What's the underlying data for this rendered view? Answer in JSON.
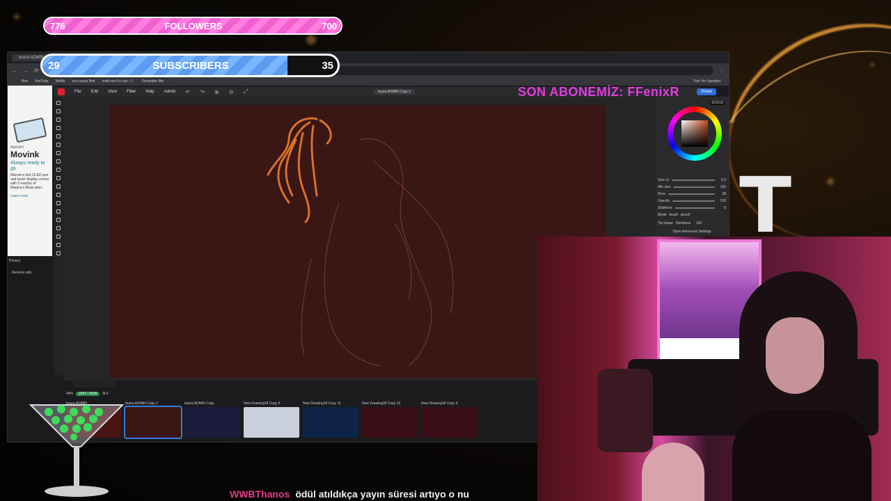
{
  "overlay": {
    "followers": {
      "label": "FOLLOWERS",
      "current": "776",
      "goal": "700",
      "progress": 1.0,
      "accent": "#f25fd1"
    },
    "subscribers": {
      "label": "SUBSCRIBERS",
      "current": "29",
      "goal": "35",
      "progress": 0.83,
      "accent": "#5b9cf0"
    },
    "latest_sub": "SON ABONEMİZ: FFenixR",
    "big_letter": "T",
    "chat": {
      "user": "WWBThanos",
      "message": "ödül atıldıkça yayın süresi artıyo o nu"
    }
  },
  "browser": {
    "tab_title": "busra ADMİN",
    "bookmarks": [
      "Bee",
      "YouTube",
      "Netflix",
      "sıra savaş filmi",
      "mark me if u can - f...",
      "Zoolander film"
    ],
    "bookmarks_right": "Tüm Yer İşaretleri"
  },
  "ad": {
    "brand": "wacom",
    "product": "Movink",
    "tagline": "Always ready to go",
    "body": "Wacom's first OLED pen and touch display comes with 3 months of Magma's Blaze plan.",
    "learn_more": "Learn more",
    "privacy": "Privacy",
    "remove_ads": "Remove ads"
  },
  "app": {
    "menu": [
      "File",
      "Edit",
      "View",
      "Filter",
      "Help",
      "Admin"
    ],
    "document_title": "busra ADMİN Copy 2",
    "share_label": "Share",
    "info": {
      "zoom": "44%",
      "size": "2997 / 4500",
      "extra": "fit 6"
    }
  },
  "color_panel": {
    "hex": "823618",
    "size_label": "Size x1",
    "brush_mode": [
      "brush",
      "pencil"
    ],
    "rows": [
      {
        "label": "Size x1",
        "value": "5.0"
      },
      {
        "label": "Min size",
        "value": "100"
      },
      {
        "label": "Flow",
        "value": "38"
      },
      {
        "label": "Opacity",
        "value": "100"
      },
      {
        "label": "Stabilizer",
        "value": "0"
      }
    ],
    "mode_label": "Mode",
    "tip_label": "Tip shape",
    "hardness_label": "Hardness",
    "hardness_value": "100",
    "advanced": "Open Advanced Settings"
  },
  "filmstrip": [
    {
      "label": "busra ADMİN",
      "color": "#4a1414",
      "active": false
    },
    {
      "label": "busra ADMİN Copy 2",
      "color": "#3a1715",
      "active": true
    },
    {
      "label": "busra ADMİN Copy",
      "color": "#1c1c3a",
      "active": false
    },
    {
      "label": "New Drawing18 Copy 6",
      "color": "#c9d0dc",
      "active": false
    },
    {
      "label": "New Drawing18 Copy 11",
      "color": "#0d2448",
      "active": false
    },
    {
      "label": "New Drawing18 Copy 10",
      "color": "#3a0e16",
      "active": false
    },
    {
      "label": "New Drawing18 Copy 4",
      "color": "#3a0e16",
      "active": false
    }
  ]
}
